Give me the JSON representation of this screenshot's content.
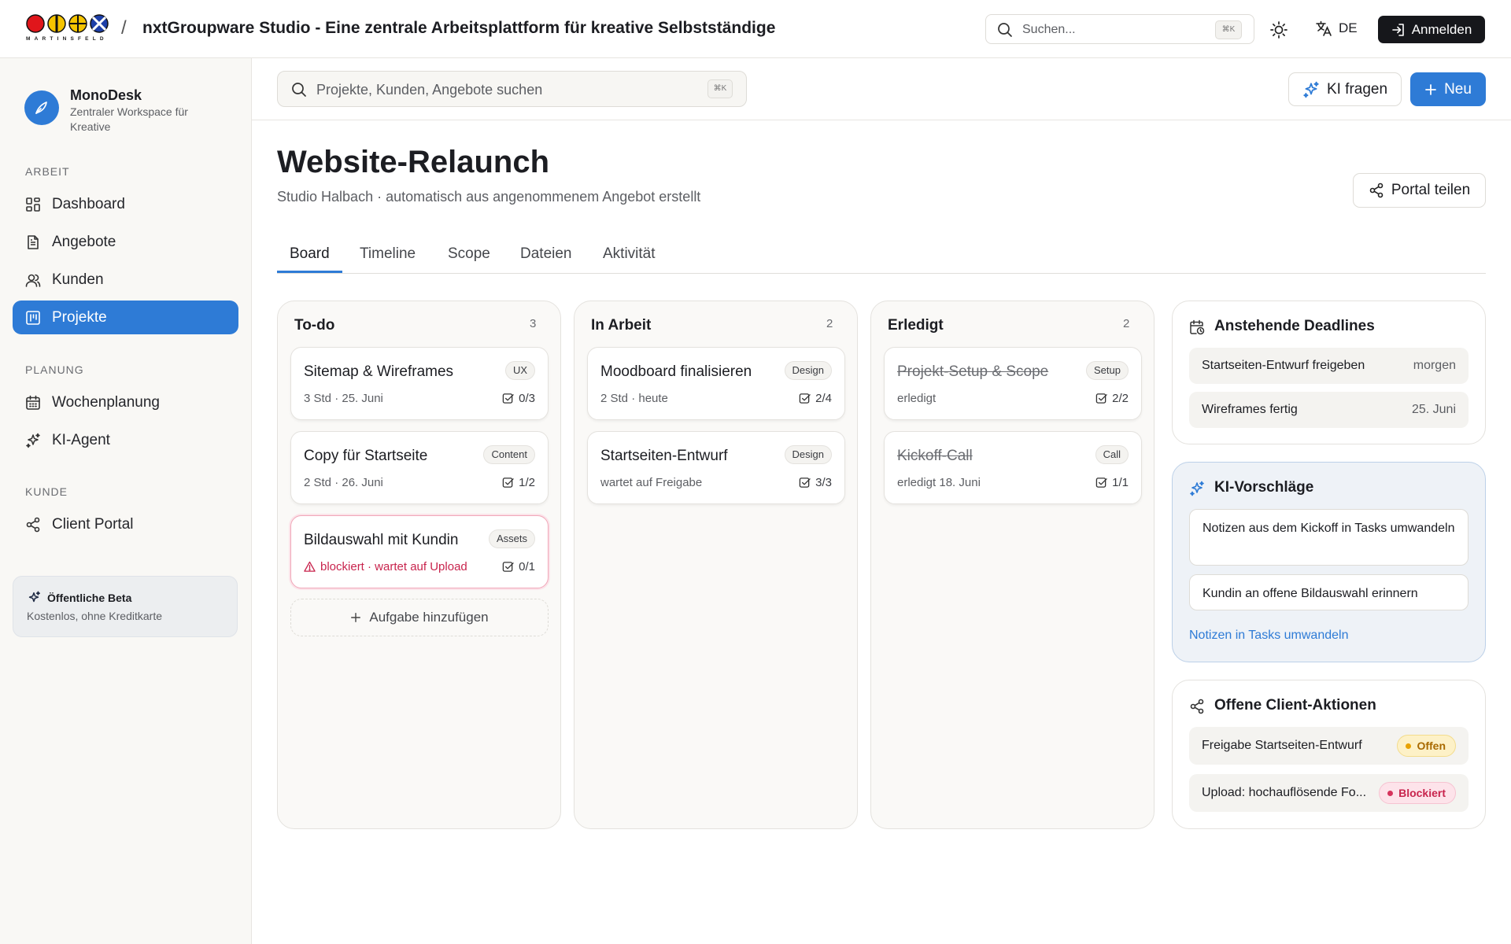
{
  "topbar": {
    "logo_word": "MARTINSFELD",
    "separator": "/",
    "title": "nxtGroupware Studio - Eine zentrale Arbeitsplattform für kreative Selbstständige",
    "search_placeholder": "Suchen...",
    "search_shortcut": "⌘K",
    "language": "DE",
    "login_label": "Anmelden"
  },
  "sidebar": {
    "app_name": "MonoDesk",
    "app_subtitle": "Zentraler Workspace für Kreative",
    "sections": [
      {
        "label": "ARBEIT",
        "items": [
          {
            "label": "Dashboard",
            "icon": "dashboard-icon"
          },
          {
            "label": "Angebote",
            "icon": "document-icon"
          },
          {
            "label": "Kunden",
            "icon": "users-icon"
          },
          {
            "label": "Projekte",
            "icon": "kanban-icon",
            "active": true
          }
        ]
      },
      {
        "label": "PLANUNG",
        "items": [
          {
            "label": "Wochenplanung",
            "icon": "calendar-icon"
          },
          {
            "label": "KI-Agent",
            "icon": "sparkles-icon"
          }
        ]
      },
      {
        "label": "KUNDE",
        "items": [
          {
            "label": "Client Portal",
            "icon": "share-icon"
          }
        ]
      }
    ],
    "beta": {
      "title": "Öffentliche Beta",
      "subtitle": "Kostenlos, ohne Kreditkarte"
    }
  },
  "header": {
    "search_placeholder": "Projekte, Kunden, Angebote suchen",
    "search_shortcut": "⌘K",
    "ki_label": "KI fragen",
    "new_label": "Neu"
  },
  "project": {
    "title": "Website-Relaunch",
    "subtitle": "Studio Halbach · automatisch aus angenommenem Angebot erstellt",
    "share_label": "Portal teilen",
    "tabs": [
      "Board",
      "Timeline",
      "Scope",
      "Dateien",
      "Aktivität"
    ],
    "active_tab": "Board"
  },
  "board": {
    "columns": [
      {
        "title": "To-do",
        "count": "3",
        "cards": [
          {
            "title": "Sitemap & Wireframes",
            "tag": "UX",
            "meta": "3 Std · 25. Juni",
            "tasks": "0/3"
          },
          {
            "title": "Copy für Startseite",
            "tag": "Content",
            "meta": "2 Std · 26. Juni",
            "tasks": "1/2"
          },
          {
            "title": "Bildauswahl mit Kundin",
            "tag": "Assets",
            "meta": "blockiert · wartet auf Upload",
            "tasks": "0/1",
            "blocked": true
          }
        ],
        "add_label": "Aufgabe hinzufügen"
      },
      {
        "title": "In Arbeit",
        "count": "2",
        "cards": [
          {
            "title": "Moodboard finalisieren",
            "tag": "Design",
            "meta": "2 Std · heute",
            "tasks": "2/4"
          },
          {
            "title": "Startseiten-Entwurf",
            "tag": "Design",
            "meta": "wartet auf Freigabe",
            "tasks": "3/3"
          }
        ]
      },
      {
        "title": "Erledigt",
        "count": "2",
        "cards": [
          {
            "title": "Projekt-Setup & Scope",
            "tag": "Setup",
            "meta": "erledigt",
            "tasks": "2/2",
            "done": true
          },
          {
            "title": "Kickoff-Call",
            "tag": "Call",
            "meta": "erledigt 18. Juni",
            "tasks": "1/1",
            "done": true
          }
        ]
      }
    ]
  },
  "panels": {
    "deadlines": {
      "title": "Anstehende Deadlines",
      "items": [
        {
          "label": "Startseiten-Entwurf freigeben",
          "when": "morgen"
        },
        {
          "label": "Wireframes fertig",
          "when": "25. Juni"
        }
      ]
    },
    "ki": {
      "title": "KI-Vorschläge",
      "suggestions": [
        "Notizen aus dem Kickoff in Tasks umwandeln",
        "Kundin an offene Bildauswahl erinnern"
      ],
      "link": "Notizen in Tasks umwandeln"
    },
    "client": {
      "title": "Offene Client-Aktionen",
      "items": [
        {
          "label": "Freigabe Startseiten-Entwurf",
          "status": "Offen"
        },
        {
          "label": "Upload: hochauflösende Fo...",
          "status": "Blockiert"
        }
      ]
    }
  },
  "colors": {
    "accent": "#2e7bd6",
    "blocked": "#c8244d",
    "open": "#e8a200",
    "dark_button": "#16171b"
  }
}
